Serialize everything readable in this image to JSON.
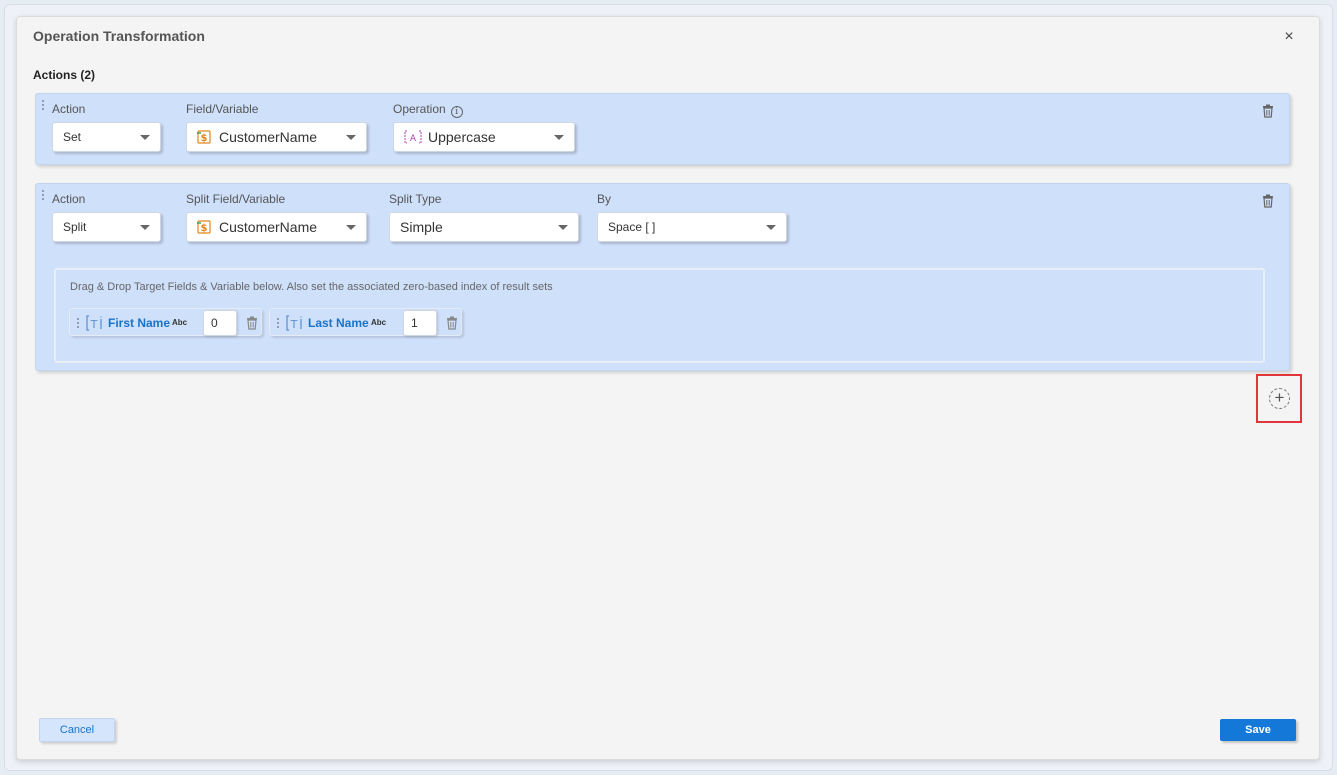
{
  "dialog": {
    "title": "Operation Transformation",
    "close_glyph": "×",
    "actions_heading": "Actions (2)"
  },
  "action1": {
    "action_label": "Action",
    "action_value": "Set",
    "field_label": "Field/Variable",
    "field_value": "CustomerName",
    "operation_label": "Operation",
    "operation_value": "Uppercase"
  },
  "action2": {
    "action_label": "Action",
    "action_value": "Split",
    "field_label": "Split Field/Variable",
    "field_value": "CustomerName",
    "split_type_label": "Split Type",
    "split_type_value": "Simple",
    "by_label": "By",
    "by_value": "Space [ ]",
    "drop_hint": "Drag & Drop Target Fields & Variable below. Also set the associated zero-based index of result sets",
    "targets": [
      {
        "name": "First Name",
        "type": "Abc",
        "index": "0"
      },
      {
        "name": "Last Name",
        "type": "Abc",
        "index": "1"
      }
    ]
  },
  "add_button": "+",
  "footer": {
    "cancel_label": "Cancel",
    "save_label": "Save"
  },
  "colors": {
    "card_bg": "#cfe0fb",
    "accent": "#1478d8",
    "highlight": "#e0353b"
  },
  "icons": [
    "close-icon",
    "info-icon",
    "variable-icon",
    "uppercase-icon",
    "trash-icon",
    "text-field-icon",
    "add-icon",
    "drag-handle-icon",
    "chevron-down-icon"
  ]
}
